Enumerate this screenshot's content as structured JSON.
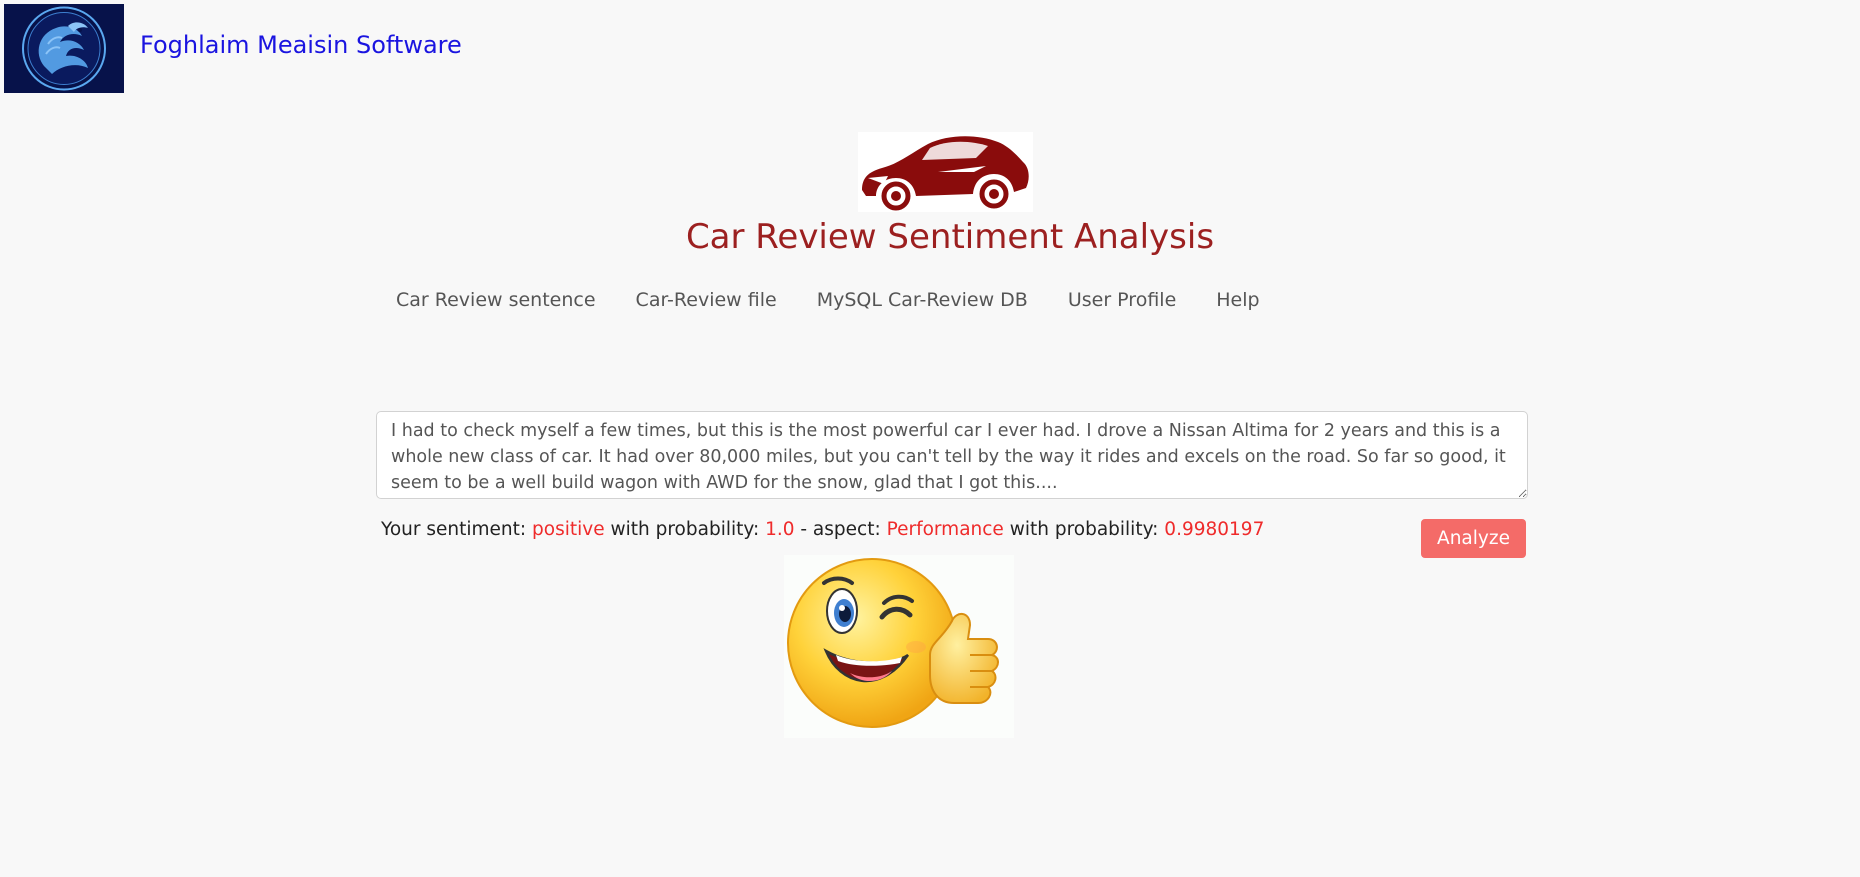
{
  "header": {
    "brand_name": "Foghlaim Meaisin Software",
    "logo_icon": "phoenix-logo-icon",
    "logo_colors": {
      "bg": "#07124a",
      "fg": "#5aa8f0"
    }
  },
  "page": {
    "title": "Car Review Sentiment Analysis",
    "car_icon": "sports-car-icon",
    "title_color": "#9c2020"
  },
  "nav": {
    "items": [
      {
        "label": "Car Review sentence"
      },
      {
        "label": "Car-Review file"
      },
      {
        "label": "MySQL Car-Review DB"
      },
      {
        "label": "User Profile"
      },
      {
        "label": "Help"
      }
    ]
  },
  "review": {
    "value": "I had to check myself a few times, but this is the most powerful car I ever had. I drove a Nissan Altima for 2 years and this is a whole new class of car. It had over 80,000 miles, but you can't tell by the way it rides and excels on the road. So far so good, it seem to be a well build wagon with AWD for the snow, glad that I got this...."
  },
  "result": {
    "prefix": "Your sentiment: ",
    "sentiment": "positive",
    "prob_label": " with probability: ",
    "sentiment_prob": "1.0",
    "aspect_label": " - aspect: ",
    "aspect": "Performance",
    "prob_label2": " with probability: ",
    "aspect_prob": "0.9980197",
    "highlight_color": "#ef2b2b"
  },
  "actions": {
    "analyze_label": "Analyze",
    "analyze_color": "#f46b68"
  },
  "feedback": {
    "emoji_icon": "winking-thumbs-up-emoji-icon"
  }
}
